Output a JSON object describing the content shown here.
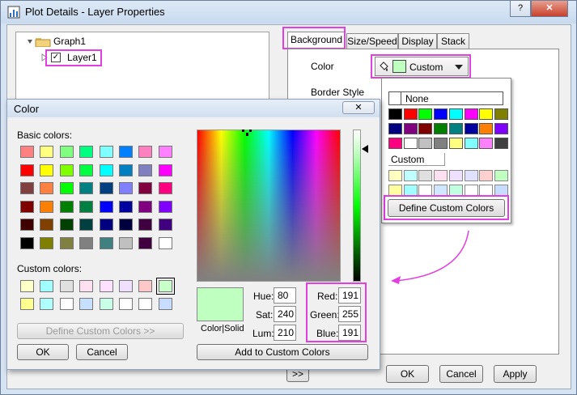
{
  "window": {
    "title": "Plot Details - Layer Properties",
    "help_btn": "?",
    "close_btn": "✕"
  },
  "tree": {
    "graph": "Graph1",
    "layer": "Layer1"
  },
  "tabs": [
    {
      "label": "Background"
    },
    {
      "label": "Size/Speed"
    },
    {
      "label": "Display"
    },
    {
      "label": "Stack"
    }
  ],
  "background_tab": {
    "color_label": "Color",
    "color_value": "Custom",
    "border_label": "Border Style"
  },
  "popup": {
    "none_label": "None",
    "custom_label": "Custom",
    "define_button": "Define Custom Colors",
    "standard_colors": [
      "#000000",
      "#ff0000",
      "#00ff00",
      "#0000ff",
      "#00ffff",
      "#ff00ff",
      "#ffff00",
      "#808000",
      "#000080",
      "#800080",
      "#800000",
      "#008000",
      "#008080",
      "#0000a0",
      "#ff8000",
      "#8000ff",
      "#ff0080",
      "#ffffff",
      "#c0c0c0",
      "#808080",
      "#ffff80",
      "#80ffff",
      "#ff80ff",
      "#404040"
    ],
    "custom_colors": [
      "#ffffc0",
      "#c0ffff",
      "#e0e0e0",
      "#ffe0f0",
      "#f0e0ff",
      "#e0e0ff",
      "#ffd0d0",
      "#c0ffc0",
      "#ffffa0",
      "#a0ffff",
      "#ffffff",
      "#d0e8ff",
      "#c0ffe0",
      "#ffffff",
      "#ffffff",
      "#c8dcff"
    ]
  },
  "color_dialog": {
    "title": "Color",
    "basic_label": "Basic colors:",
    "custom_label": "Custom colors:",
    "define_button": "Define Custom Colors >>",
    "ok": "OK",
    "cancel": "Cancel",
    "add_button": "Add to Custom Colors",
    "color_solid": "Color|Solid",
    "hue_label": "Hue:",
    "hue": "80",
    "sat_label": "Sat:",
    "sat": "240",
    "lum_label": "Lum:",
    "lum": "210",
    "red_label": "Red:",
    "red": "191",
    "green_label": "Green:",
    "green": "255",
    "blue_label": "Blue:",
    "blue": "191",
    "current_color": "#bfffbf",
    "basic_colors": [
      "#ff8080",
      "#ffff80",
      "#80ff80",
      "#00ff80",
      "#80ffff",
      "#0080ff",
      "#ff80c0",
      "#ff80ff",
      "#ff0000",
      "#ffff00",
      "#80ff00",
      "#00ff40",
      "#00ffff",
      "#0080c0",
      "#8080c0",
      "#ff00ff",
      "#804040",
      "#ff8040",
      "#00ff00",
      "#008080",
      "#004080",
      "#8080ff",
      "#800040",
      "#ff0080",
      "#800000",
      "#ff8000",
      "#008000",
      "#008040",
      "#0000ff",
      "#0000a0",
      "#800080",
      "#8000ff",
      "#400000",
      "#804000",
      "#004000",
      "#004040",
      "#000080",
      "#000040",
      "#400040",
      "#400080",
      "#000000",
      "#808000",
      "#808040",
      "#808080",
      "#408080",
      "#c0c0c0",
      "#400040",
      "#ffffff"
    ],
    "custom_colors": [
      "#ffffc8",
      "#a0ffff",
      "#e0e0e0",
      "#ffe0f0",
      "#ffe0ff",
      "#f0e0ff",
      "#ffc8c8",
      "#c8ffc8",
      "#ffff90",
      "#b0ffff",
      "#ffffff",
      "#c8e0ff",
      "#c8ffe8",
      "#ffffff",
      "#ffffff",
      "#c8dcff"
    ]
  },
  "main_buttons": {
    "more": ">>",
    "ok": "OK",
    "cancel": "Cancel",
    "apply": "Apply"
  }
}
